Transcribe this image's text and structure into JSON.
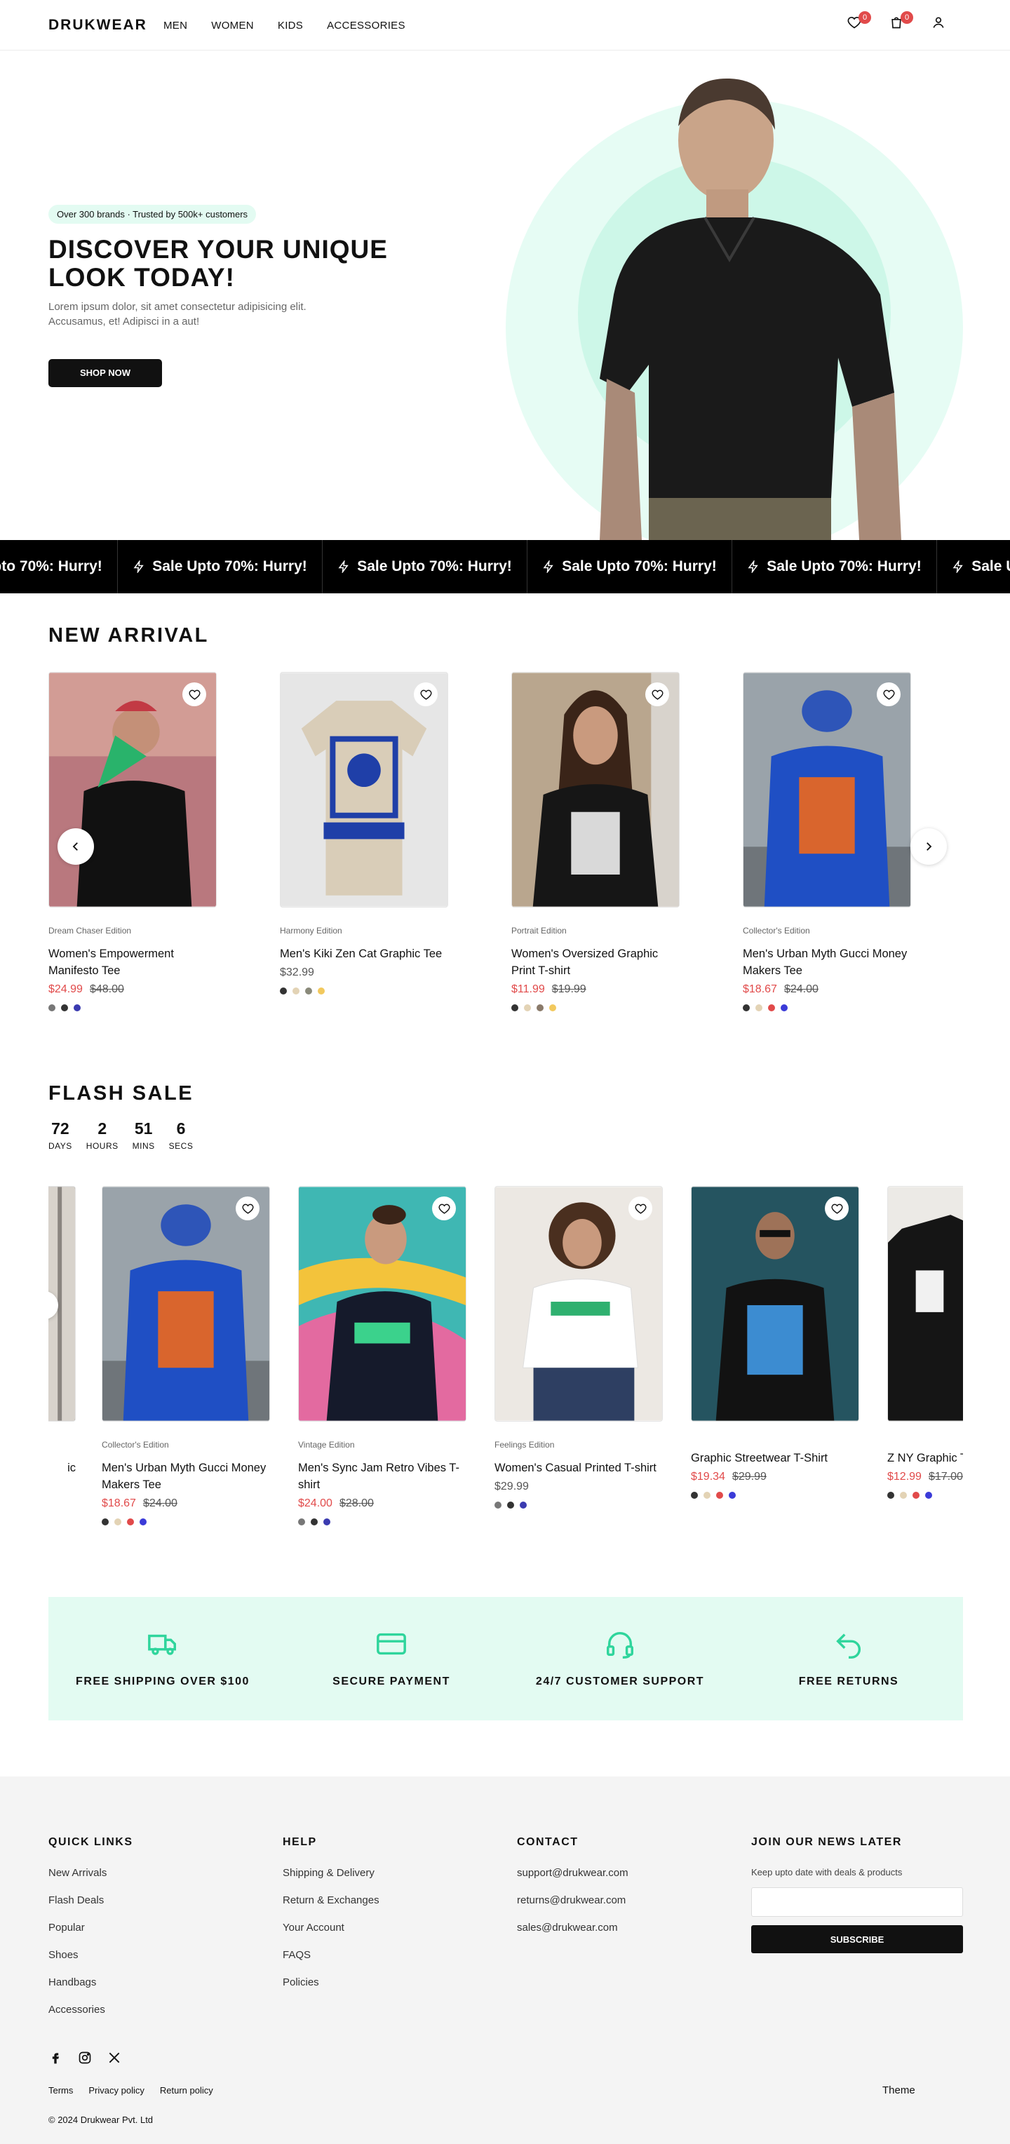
{
  "header": {
    "logo": "DRUKWEAR",
    "nav": [
      "MEN",
      "WOMEN",
      "KIDS",
      "ACCESSORIES"
    ],
    "wishlist_count": "0",
    "cart_count": "0"
  },
  "hero": {
    "pill": "Over 300 brands · Trusted by 500k+ customers",
    "title": "DISCOVER YOUR UNIQUE LOOK TODAY!",
    "subtitle": "Lorem ipsum dolor, sit amet consectetur adipisicing elit. Accusamus, et! Adipisci in a aut!",
    "cta": "SHOP NOW"
  },
  "marquee": {
    "text": "Sale Upto 70%: Hurry!"
  },
  "new_arrival": {
    "title": "NEW ARRIVAL",
    "products": [
      {
        "edition": "Dream Chaser Edition",
        "name": "Women's Empowerment Manifesto Tee",
        "price": "$24.99",
        "old_price": "$48.00",
        "colors": [
          "#777777",
          "#333333",
          "#3b3bb0"
        ]
      },
      {
        "edition": "Harmony Edition",
        "name": "Men's Kiki Zen Cat Graphic Tee",
        "price": "$32.99",
        "old_price": "",
        "colors": [
          "#333333",
          "#e3d3b5",
          "#8a8a7a",
          "#f2c95e"
        ]
      },
      {
        "edition": "Portrait Edition",
        "name": "Women's Oversized Graphic Print T-shirt",
        "price": "$11.99",
        "old_price": "$19.99",
        "colors": [
          "#333333",
          "#e3d3b5",
          "#8a7a6a",
          "#f2c95e"
        ]
      },
      {
        "edition": "Collector's Edition",
        "name": "Men's Urban Myth Gucci Money Makers Tee",
        "price": "$18.67",
        "old_price": "$24.00",
        "colors": [
          "#333333",
          "#e3d3b5",
          "#e14a4a",
          "#3b3bd8"
        ]
      }
    ]
  },
  "flash_sale": {
    "title": "FLASH SALE",
    "countdown": [
      {
        "value": "72",
        "label": "DAYS"
      },
      {
        "value": "2",
        "label": "HOURS"
      },
      {
        "value": "51",
        "label": "MINS"
      },
      {
        "value": "6",
        "label": "SECS"
      }
    ],
    "partial_left_name": "ic",
    "products": [
      {
        "edition": "Collector's Edition",
        "name": "Men's Urban Myth Gucci Money Makers Tee",
        "price": "$18.67",
        "old_price": "$24.00",
        "colors": [
          "#333333",
          "#e3d3b5",
          "#e14a4a",
          "#3b3bd8"
        ]
      },
      {
        "edition": "Vintage Edition",
        "name": "Men's Sync Jam Retro Vibes T-shirt",
        "price": "$24.00",
        "old_price": "$28.00",
        "colors": [
          "#777777",
          "#333333",
          "#3b3bb0"
        ]
      },
      {
        "edition": "Feelings Edition",
        "name": "Women's Casual Printed T-shirt",
        "price": "$29.99",
        "old_price": "",
        "colors": [
          "#777777",
          "#333333",
          "#3b3bb0"
        ]
      },
      {
        "edition": "",
        "name": "Graphic Streetwear T-Shirt",
        "price": "$19.34",
        "old_price": "$29.99",
        "colors": [
          "#333333",
          "#e3d3b5",
          "#e14a4a",
          "#3b3bd8"
        ]
      },
      {
        "edition": "",
        "name": "Z NY Graphic T Typography E",
        "price": "$12.99",
        "old_price": "$17.00",
        "colors": [
          "#333333",
          "#e3d3b5",
          "#e14a4a",
          "#3b3bd8"
        ]
      }
    ]
  },
  "features": [
    {
      "label": "FREE SHIPPING OVER $100",
      "icon": "truck-icon"
    },
    {
      "label": "SECURE PAYMENT",
      "icon": "credit-card-icon"
    },
    {
      "label": "24/7 CUSTOMER SUPPORT",
      "icon": "headset-icon"
    },
    {
      "label": "FREE RETURNS",
      "icon": "return-arrow-icon"
    }
  ],
  "footer": {
    "quick_links_title": "QUICK LINKS",
    "quick_links": [
      "New Arrivals",
      "Flash Deals",
      "Popular",
      "Shoes",
      "Handbags",
      "Accessories"
    ],
    "help_title": "HELP",
    "help_links": [
      "Shipping & Delivery",
      "Return & Exchanges",
      "Your Account",
      "FAQS",
      "Policies"
    ],
    "contact_title": "CONTACT",
    "contact_links": [
      "support@drukwear.com",
      "returns@drukwear.com",
      "sales@drukwear.com"
    ],
    "newsletter_title": "JOIN OUR NEWS LATER",
    "newsletter_sub": "Keep upto date with deals & products",
    "newsletter_placeholder": "",
    "subscribe": "SUBSCRIBE",
    "legal": [
      "Terms",
      "Privacy policy",
      "Return policy"
    ],
    "theme": "Theme",
    "copyright": "© 2024 Drukwear Pvt. Ltd"
  },
  "colors": {
    "accent_mint": "#e3fbf2",
    "sale_red": "#e14a4a",
    "icon_green": "#2fd59c"
  }
}
